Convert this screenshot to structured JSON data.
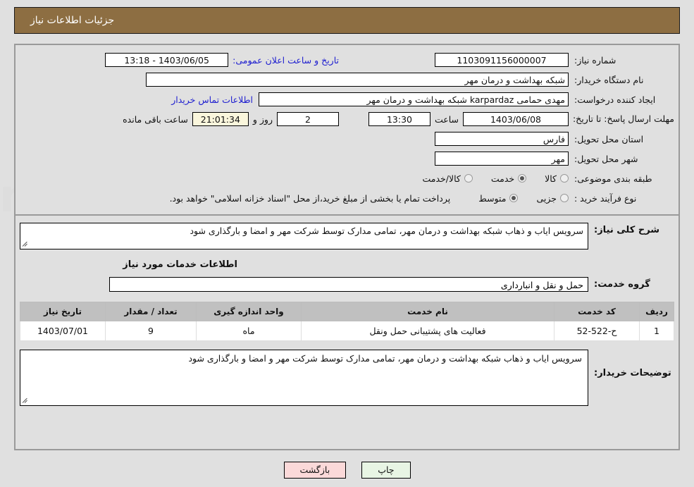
{
  "header": {
    "title": "جزئیات اطلاعات نیاز"
  },
  "info": {
    "need_number_label": "شماره نیاز:",
    "need_number_value": "1103091156000007",
    "announce_datetime_label": "تاریخ و ساعت اعلان عمومی:",
    "announce_datetime_value": "1403/06/05 - 13:18",
    "buyer_org_label": "نام دستگاه خریدار:",
    "buyer_org_value": "شبکه بهداشت و درمان مهر",
    "requester_label": "ایجاد کننده درخواست:",
    "requester_value": "مهدی حمامی karpardaz شبکه بهداشت و درمان مهر",
    "contact_link": "اطلاعات تماس خریدار",
    "deadline_label": "مهلت ارسال پاسخ: تا تاریخ:",
    "deadline_date": "1403/06/08",
    "time_label": "ساعت",
    "deadline_time": "13:30",
    "days_remaining": "2",
    "days_label": "روز و",
    "countdown": "21:01:34",
    "countdown_label": "ساعت باقی مانده",
    "province_label": "استان محل تحویل:",
    "province_value": "فارس",
    "city_label": "شهر محل تحویل:",
    "city_value": "مهر",
    "category_label": "طبقه بندی موضوعی:",
    "category_options": [
      {
        "label": "کالا",
        "selected": false
      },
      {
        "label": "خدمت",
        "selected": true
      },
      {
        "label": "کالا/خدمت",
        "selected": false
      }
    ],
    "process_label": "نوع فرآیند خرید :",
    "process_options": [
      {
        "label": "جزیی",
        "selected": false
      },
      {
        "label": "متوسط",
        "selected": true
      }
    ],
    "process_note": "پرداخت تمام یا بخشی از مبلغ خرید،از محل \"اسناد خزانه اسلامی\" خواهد بود."
  },
  "description": {
    "label": "شرح کلی نیاز:",
    "value": "سرویس ایاب و ذهاب شبکه بهداشت و درمان مهر، تمامی مدارک توسط شرکت مهر و امضا و بارگذاری شود",
    "section_title": "اطلاعات خدمات مورد نیاز",
    "service_group_label": "گروه خدمت:",
    "service_group_value": "حمل و نقل و انبارداری"
  },
  "table": {
    "columns": [
      "ردیف",
      "کد خدمت",
      "نام خدمت",
      "واحد اندازه گیری",
      "تعداد / مقدار",
      "تاریخ نیاز"
    ],
    "rows": [
      {
        "radif": "1",
        "code": "ح-522-52",
        "name": "فعالیت های پشتیبانی حمل ونقل",
        "unit": "ماه",
        "qty": "9",
        "date": "1403/07/01"
      }
    ]
  },
  "comments": {
    "label": "توضیحات خریدار:",
    "value": "سرویس ایاب و ذهاب شبکه بهداشت و درمان مهر، تمامی مدارک توسط شرکت مهر و امضا و بارگذاری شود"
  },
  "footer": {
    "print_label": "چاپ",
    "back_label": "بازگشت"
  },
  "colors": {
    "header_bg": "#8d6e42",
    "page_bg": "#e0e0e0",
    "link": "#2020d0",
    "print_btn": "#e8f5e4",
    "back_btn": "#fbd9d9",
    "highlight_field": "#faf6dc"
  }
}
